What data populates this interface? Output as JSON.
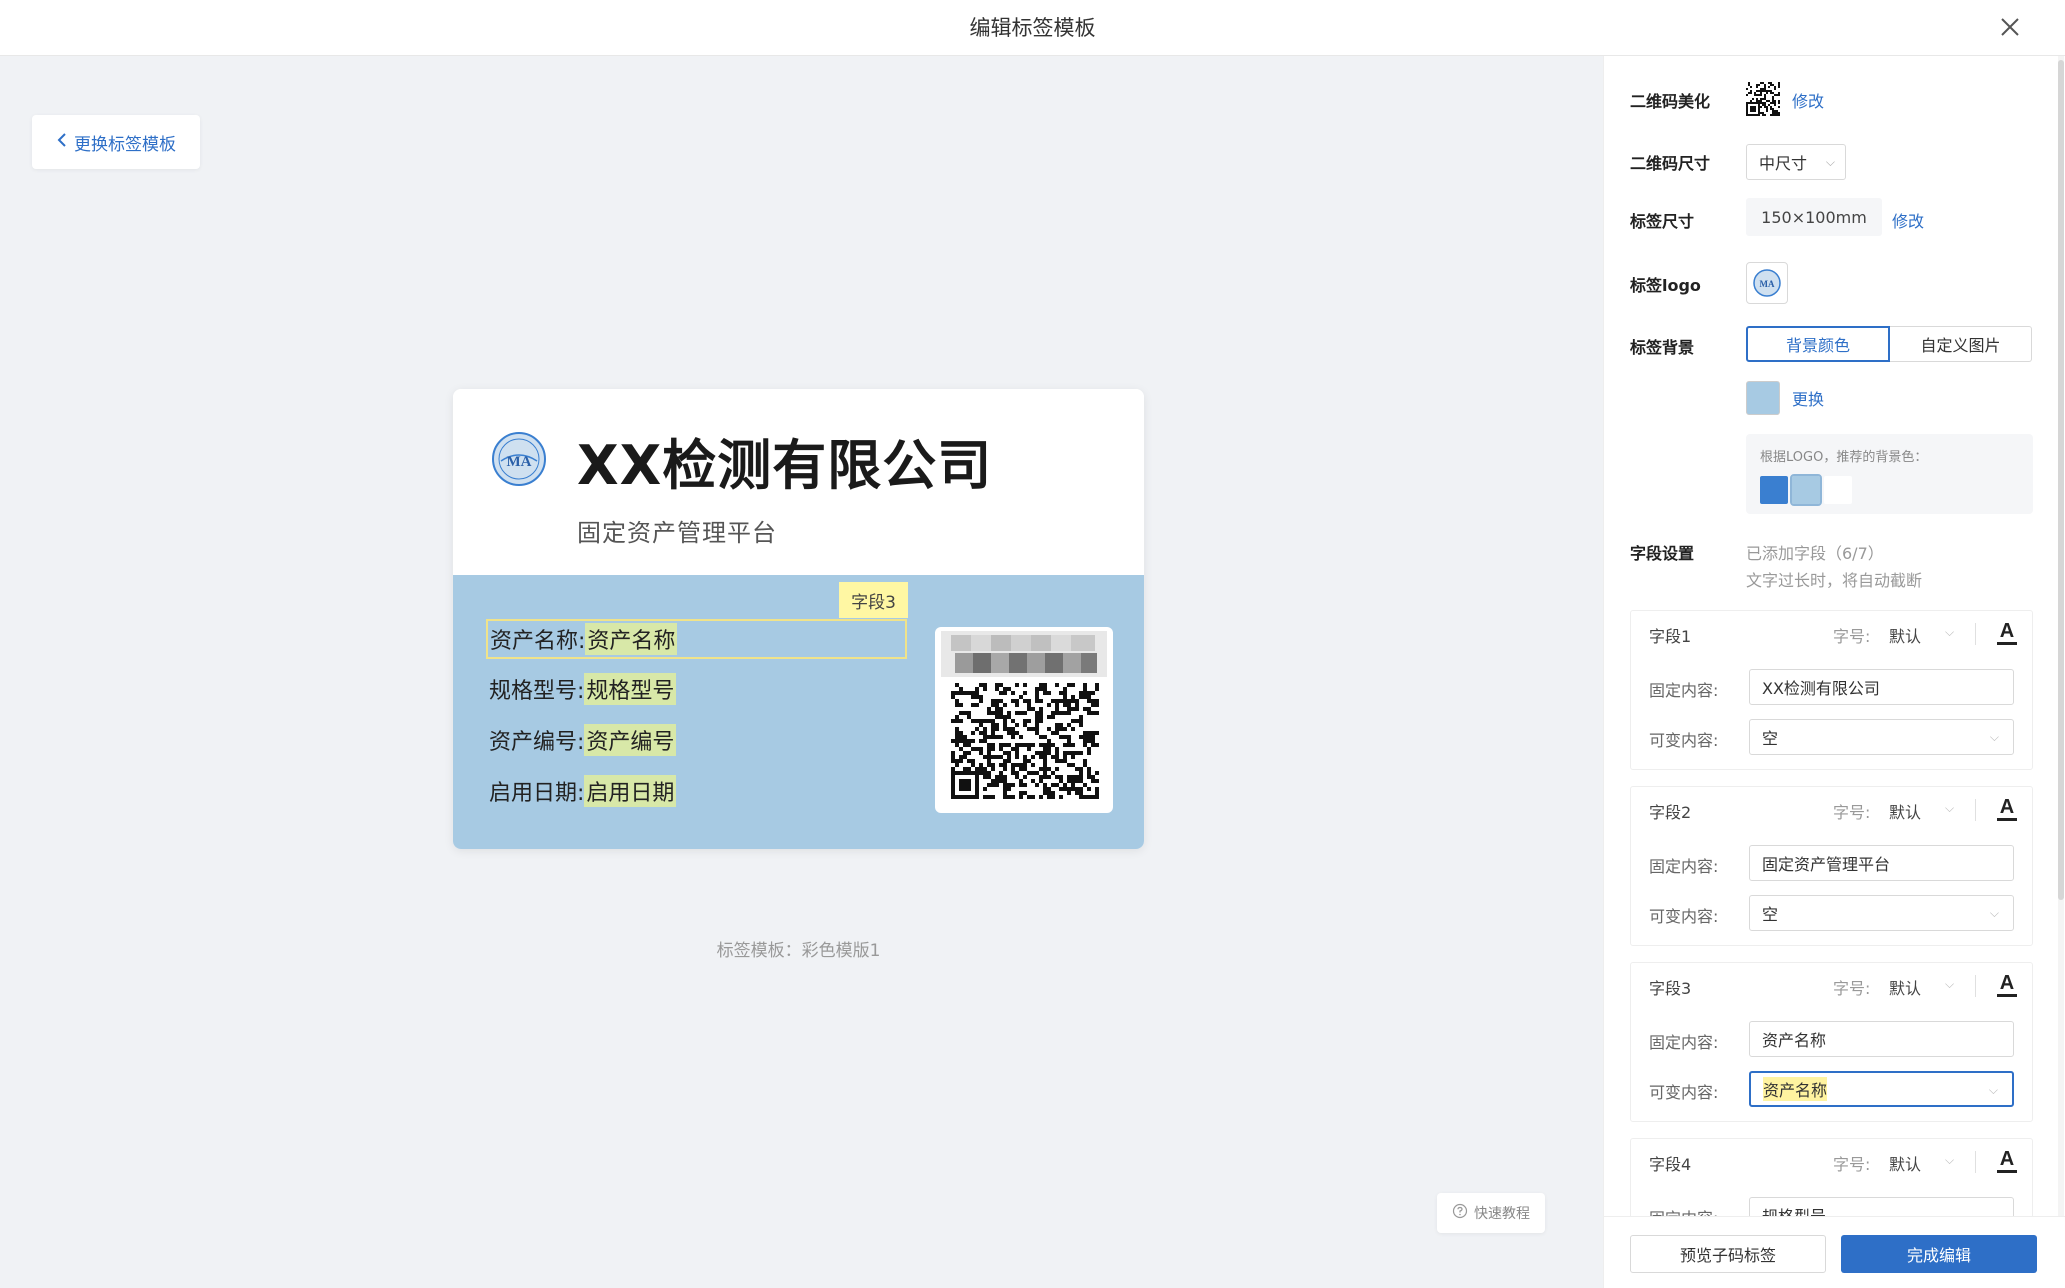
{
  "header": {
    "title": "编辑标签模板"
  },
  "canvas": {
    "back_label": "更换标签模板",
    "tutorial_label": "快速教程",
    "caption": "标签模板：彩色模版1"
  },
  "label": {
    "company": "XX检测有限公司",
    "subtitle": "固定资产管理平台",
    "active_field_tag": "字段3",
    "rows": [
      {
        "label": "资产名称:",
        "value": "资产名称"
      },
      {
        "label": "规格型号:",
        "value": "规格型号"
      },
      {
        "label": "资产编号:",
        "value": "资产编号"
      },
      {
        "label": "启用日期:",
        "value": "启用日期"
      }
    ],
    "background_color": "#a7cae3"
  },
  "panel": {
    "qr_beautify": {
      "label": "二维码美化",
      "link": "修改"
    },
    "qr_size": {
      "label": "二维码尺寸",
      "value": "中尺寸"
    },
    "label_size": {
      "label": "标签尺寸",
      "value": "150×100mm",
      "link": "修改"
    },
    "label_logo": {
      "label": "标签logo"
    },
    "label_bg": {
      "label": "标签背景",
      "tabs": [
        "背景颜色",
        "自定义图片"
      ],
      "change_link": "更换",
      "recommend_text": "根据LOGO，推荐的背景色：",
      "recommend_colors": [
        "#3a7fd0",
        "#a7cae3",
        "#ffffff"
      ]
    },
    "field_settings": {
      "label": "字段设置",
      "info1": "已添加字段（6/7）",
      "info2": "文字过长时，将自动截断"
    },
    "field_size_label": "字号:",
    "fixed_label": "固定内容:",
    "variable_label": "可变内容:",
    "fields": [
      {
        "name": "字段1",
        "size": "默认",
        "fixed": "XX检测有限公司",
        "variable": "空"
      },
      {
        "name": "字段2",
        "size": "默认",
        "fixed": "固定资产管理平台",
        "variable": "空"
      },
      {
        "name": "字段3",
        "size": "默认",
        "fixed": "资产名称",
        "variable": "资产名称"
      },
      {
        "name": "字段4",
        "size": "默认",
        "fixed": "规格型号",
        "variable": ""
      }
    ],
    "footer": {
      "preview": "预览子码标签",
      "done": "完成编辑"
    }
  },
  "colors": {
    "accent": "#2e6fc7",
    "canvas_bg": "#f0f2f5"
  }
}
